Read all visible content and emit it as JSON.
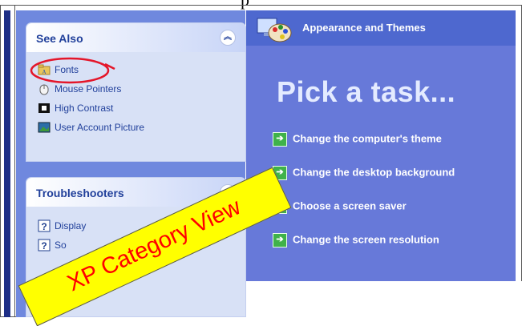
{
  "caption": "XP Category View",
  "header_fragment": "p",
  "see_also": {
    "title": "See Also",
    "items": [
      {
        "label": "Fonts",
        "icon": "fonts-folder-icon"
      },
      {
        "label": "Mouse Pointers",
        "icon": "mouse-pointer-icon"
      },
      {
        "label": "High Contrast",
        "icon": "high-contrast-icon"
      },
      {
        "label": "User Account Picture",
        "icon": "user-picture-icon"
      }
    ]
  },
  "troubleshooters": {
    "title": "Troubleshooters",
    "items": [
      {
        "label": "Display",
        "icon": "help-icon"
      },
      {
        "label": "So",
        "icon": "help-icon"
      }
    ]
  },
  "main": {
    "category_title": "Appearance and Themes",
    "heading": "Pick a task...",
    "tasks": [
      "Change the computer's theme",
      "Change the desktop background",
      "Choose a screen saver",
      "Change the screen resolution"
    ]
  },
  "colors": {
    "left_pane": "#6f88de",
    "right_pane": "#6779d9",
    "panel": "#d8e1f6",
    "banner": "#ffff00",
    "banner_text": "#ff0000",
    "annotation_circle": "#e4162a"
  }
}
